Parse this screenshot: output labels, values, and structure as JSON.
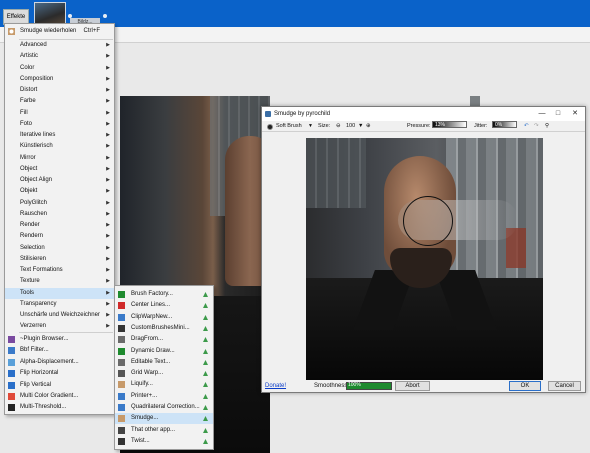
{
  "menubar": {
    "effekte": "Effekte",
    "doc_tab": "Bildz..."
  },
  "colors": {
    "titlebar": "#0a62c9",
    "highlight": "#cde3f7",
    "smoothness_fill": "#1e8a2e"
  },
  "effects_menu": {
    "repeat_label": "Smudge wiederholen",
    "repeat_shortcut": "Ctrl+F",
    "items": [
      "Advanced",
      "Artistic",
      "Color",
      "Composition",
      "Distort",
      "Farbe",
      "Fill",
      "Foto",
      "Iterative lines",
      "Künstlerisch",
      "Mirror",
      "Object",
      "Object Align",
      "Objekt",
      "PolyGlitch",
      "Rauschen",
      "Render",
      "Rendern",
      "Selection",
      "Stilisieren",
      "Text Formations",
      "Texture",
      "Tools",
      "Transparency",
      "Unschärfe und Weichzeichner",
      "Verzerren"
    ],
    "plugin_items": [
      "~Plugin Browser...",
      "Bbf Filter...",
      "Alpha-Displacement...",
      "Flip Horizontal",
      "Flip Vertical",
      "Multi Color Gradient...",
      "Multi-Threshold..."
    ]
  },
  "tools_menu": {
    "items": [
      "Brush Factory...",
      "Center Lines...",
      "ClipWarpNew...",
      "CustomBrushesMini...",
      "DragFrom...",
      "Dynamic Draw...",
      "Editable Text...",
      "Grid Warp...",
      "Liquify...",
      "Printer+...",
      "Quadrilateral Correction...",
      "Smudge...",
      "That other app...",
      "Twist..."
    ],
    "highlighted": "Smudge..."
  },
  "dialog": {
    "title": "Smudge by pyrochild",
    "brush_name": "Soft Brush",
    "size_label": "Size:",
    "size_value": "100",
    "pressure_label": "Pressure:",
    "pressure_value": "13%",
    "pressure_level": 0.13,
    "jitter_label": "Jitter:",
    "jitter_value": "0%",
    "donate": "Donate!",
    "smoothness_label": "Smoothness:",
    "smoothness_value": "100%",
    "smoothness_level": 1.0,
    "abort": "Abort",
    "ok": "OK",
    "cancel": "Cancel"
  }
}
